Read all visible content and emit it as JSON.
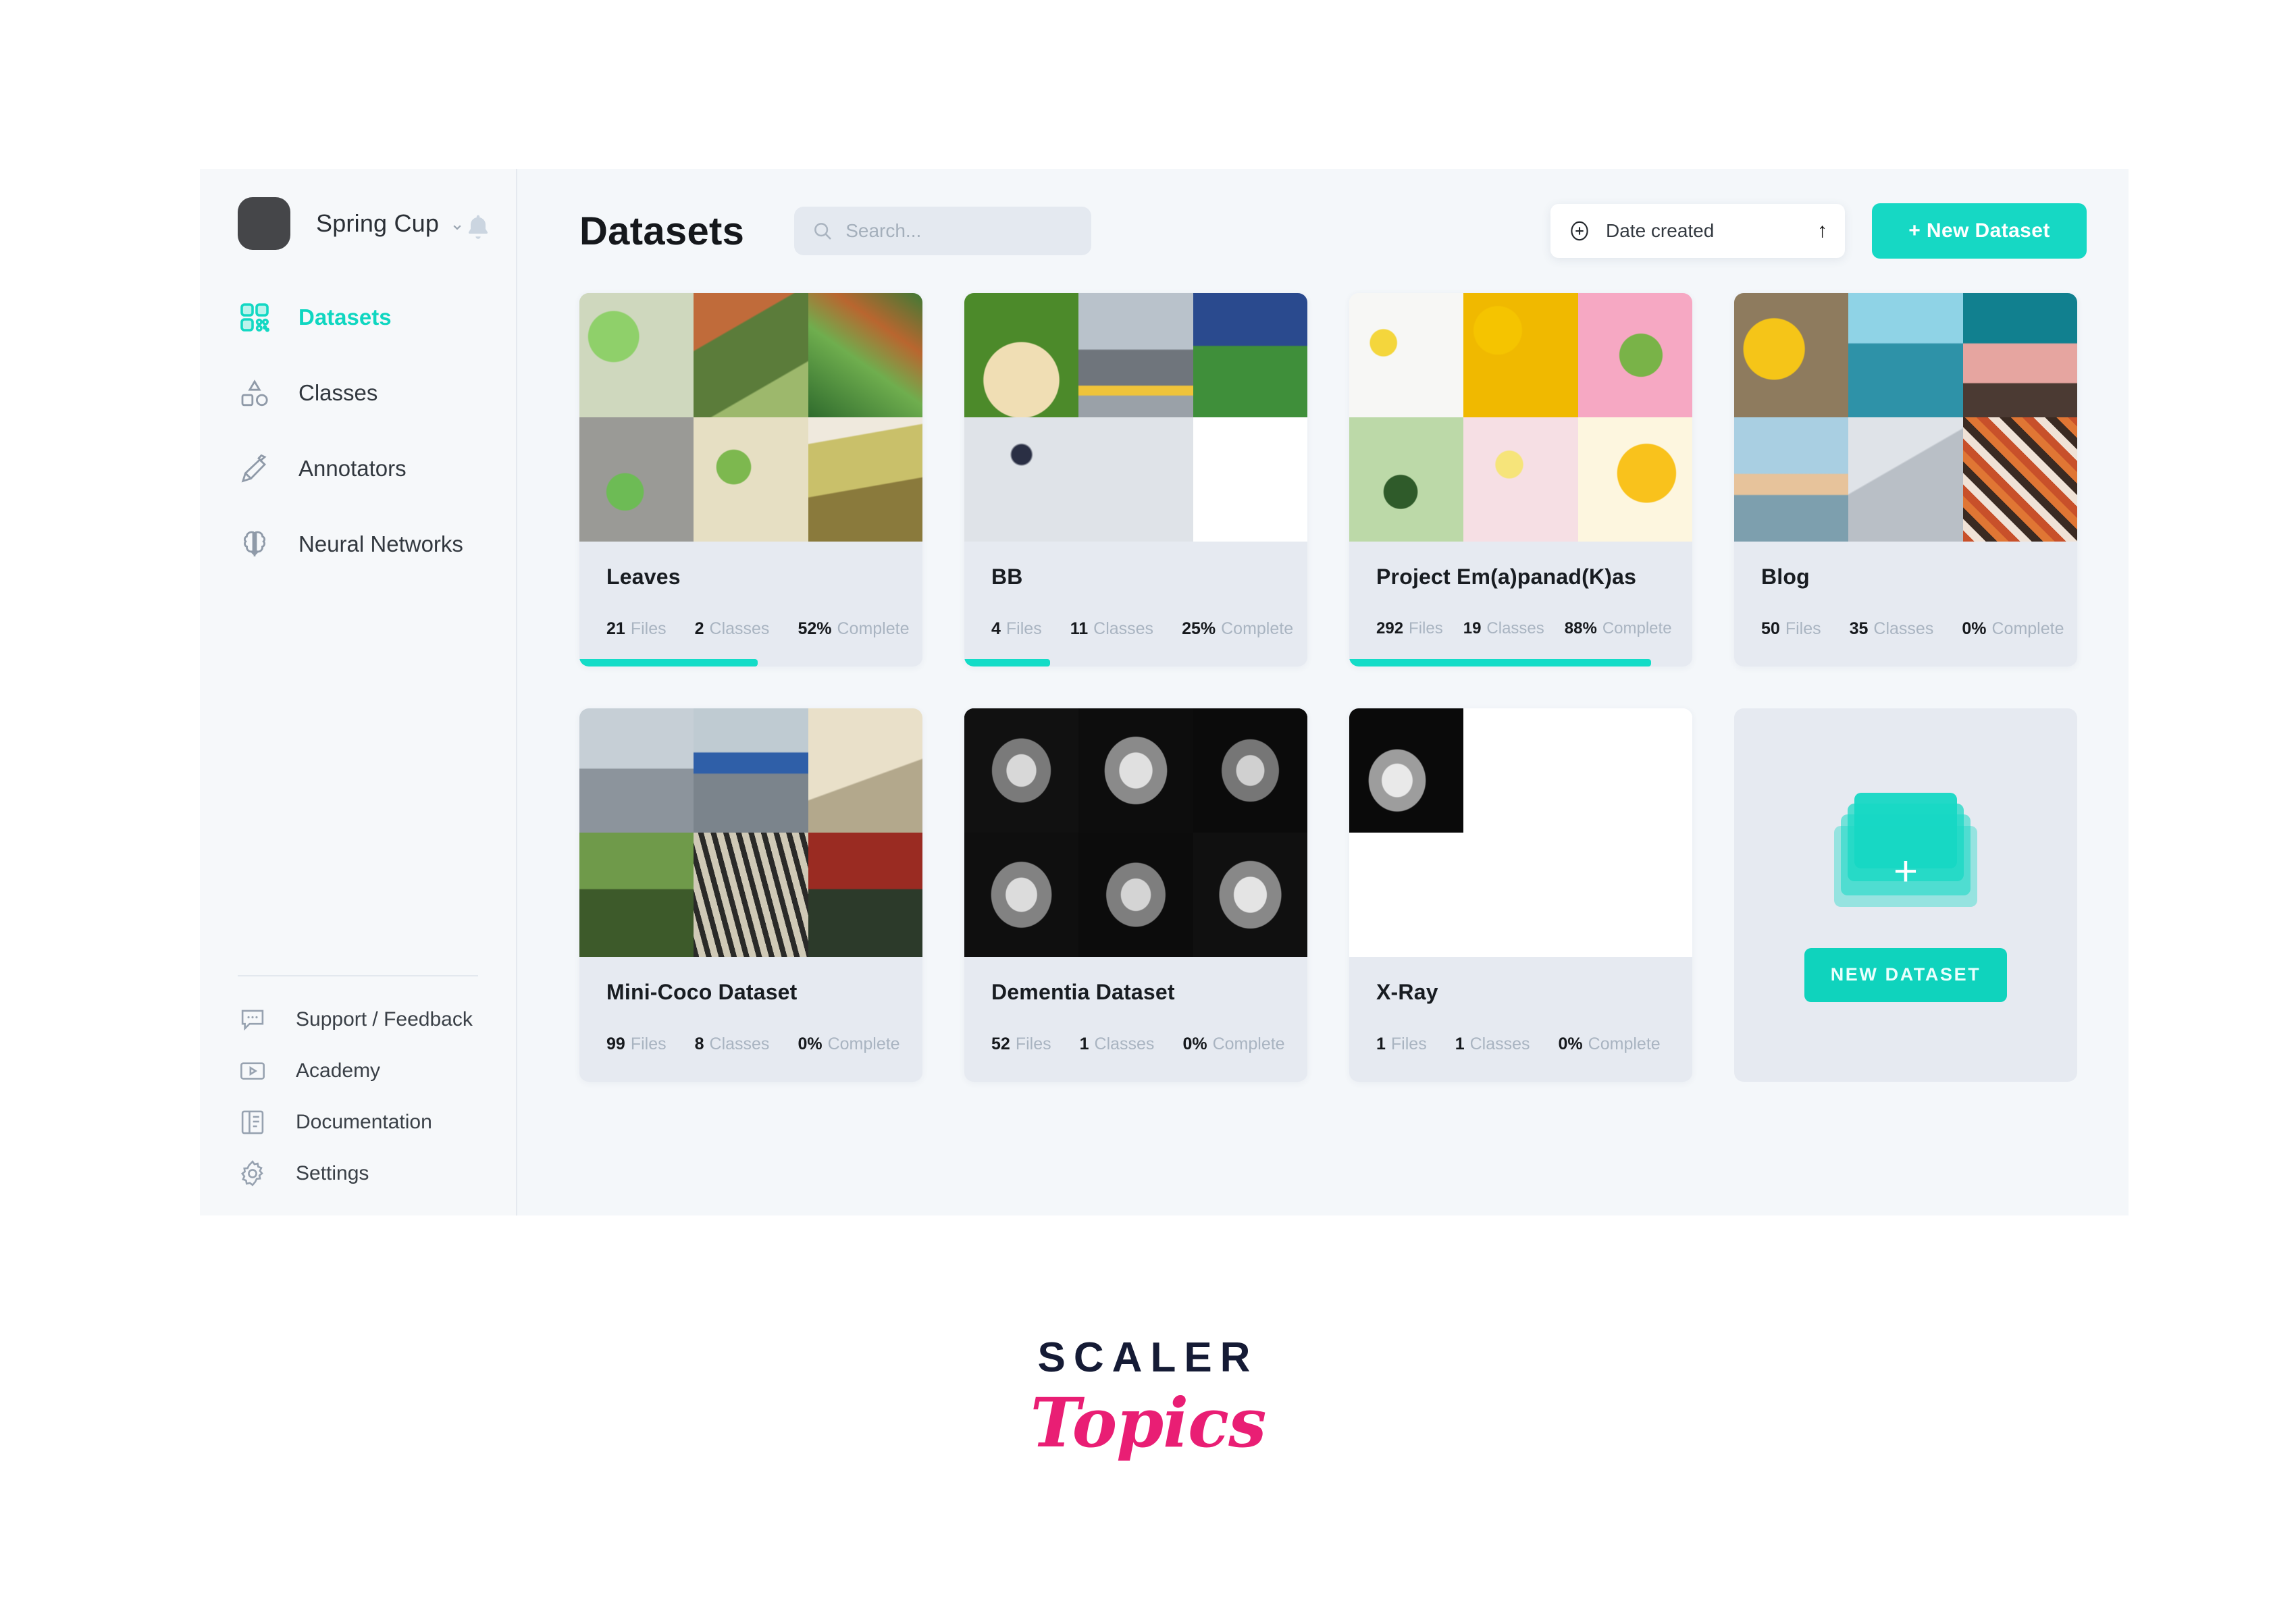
{
  "sidebar": {
    "workspace": {
      "name": "Spring Cup",
      "caret": "chevron-down-icon",
      "logo": "workspace-logo"
    },
    "notification_icon": "bell-icon",
    "items": [
      {
        "label": "Datasets",
        "icon": "grid-blocks-icon",
        "active": true
      },
      {
        "label": "Classes",
        "icon": "shapes-icon",
        "active": false
      },
      {
        "label": "Annotators",
        "icon": "pen-nib-icon",
        "active": false
      },
      {
        "label": "Neural Networks",
        "icon": "brain-icon",
        "active": false
      }
    ],
    "bottom_items": [
      {
        "label": "Support / Feedback",
        "icon": "chat-bubble-icon"
      },
      {
        "label": "Academy",
        "icon": "video-play-icon"
      },
      {
        "label": "Documentation",
        "icon": "book-icon"
      },
      {
        "label": "Settings",
        "icon": "gear-icon"
      }
    ]
  },
  "header": {
    "title": "Datasets",
    "search": {
      "placeholder": "Search...",
      "value": "",
      "icon": "search-icon"
    },
    "sort": {
      "label": "Date created",
      "leading_icon": "plus-circle-icon",
      "direction_icon": "arrow-up-icon"
    },
    "new_dataset_button": "+ New Dataset"
  },
  "datasets": [
    {
      "name": "Leaves",
      "files": "21",
      "files_label": "Files",
      "classes": "2",
      "classes_label": "Classes",
      "percent": "52%",
      "complete_label": "Complete",
      "progress": 52
    },
    {
      "name": "BB",
      "files": "4",
      "files_label": "Files",
      "classes": "11",
      "classes_label": "Classes",
      "percent": "25%",
      "complete_label": "Complete",
      "progress": 25
    },
    {
      "name": "Project Em(a)panad(K)as",
      "files": "292",
      "files_label": "Files",
      "classes": "19",
      "classes_label": "Classes",
      "percent": "88%",
      "complete_label": "Complete",
      "progress": 88
    },
    {
      "name": "Blog",
      "files": "50",
      "files_label": "Files",
      "classes": "35",
      "classes_label": "Classes",
      "percent": "0%",
      "complete_label": "Complete",
      "progress": 0
    },
    {
      "name": "Mini-Coco Dataset",
      "files": "99",
      "files_label": "Files",
      "classes": "8",
      "classes_label": "Classes",
      "percent": "0%",
      "complete_label": "Complete",
      "progress": 0
    },
    {
      "name": "Dementia Dataset",
      "files": "52",
      "files_label": "Files",
      "classes": "1",
      "classes_label": "Classes",
      "percent": "0%",
      "complete_label": "Complete",
      "progress": 0
    },
    {
      "name": "X-Ray",
      "files": "1",
      "files_label": "Files",
      "classes": "1",
      "classes_label": "Classes",
      "percent": "0%",
      "complete_label": "Complete",
      "progress": 0
    }
  ],
  "new_dataset_card": {
    "button_label": "NEW DATASET",
    "icon": "stacked-layers-plus-icon",
    "plus": "+"
  },
  "footer_logo": {
    "primary": "SCALER",
    "secondary": "Topics"
  },
  "colors": {
    "accent": "#16d8c4",
    "card_bg": "#e6eaf1",
    "page_bg": "#f4f7fa",
    "sidebar_bg": "#f6f8fa",
    "logo_pink": "#e91e74",
    "logo_navy": "#151b35"
  }
}
